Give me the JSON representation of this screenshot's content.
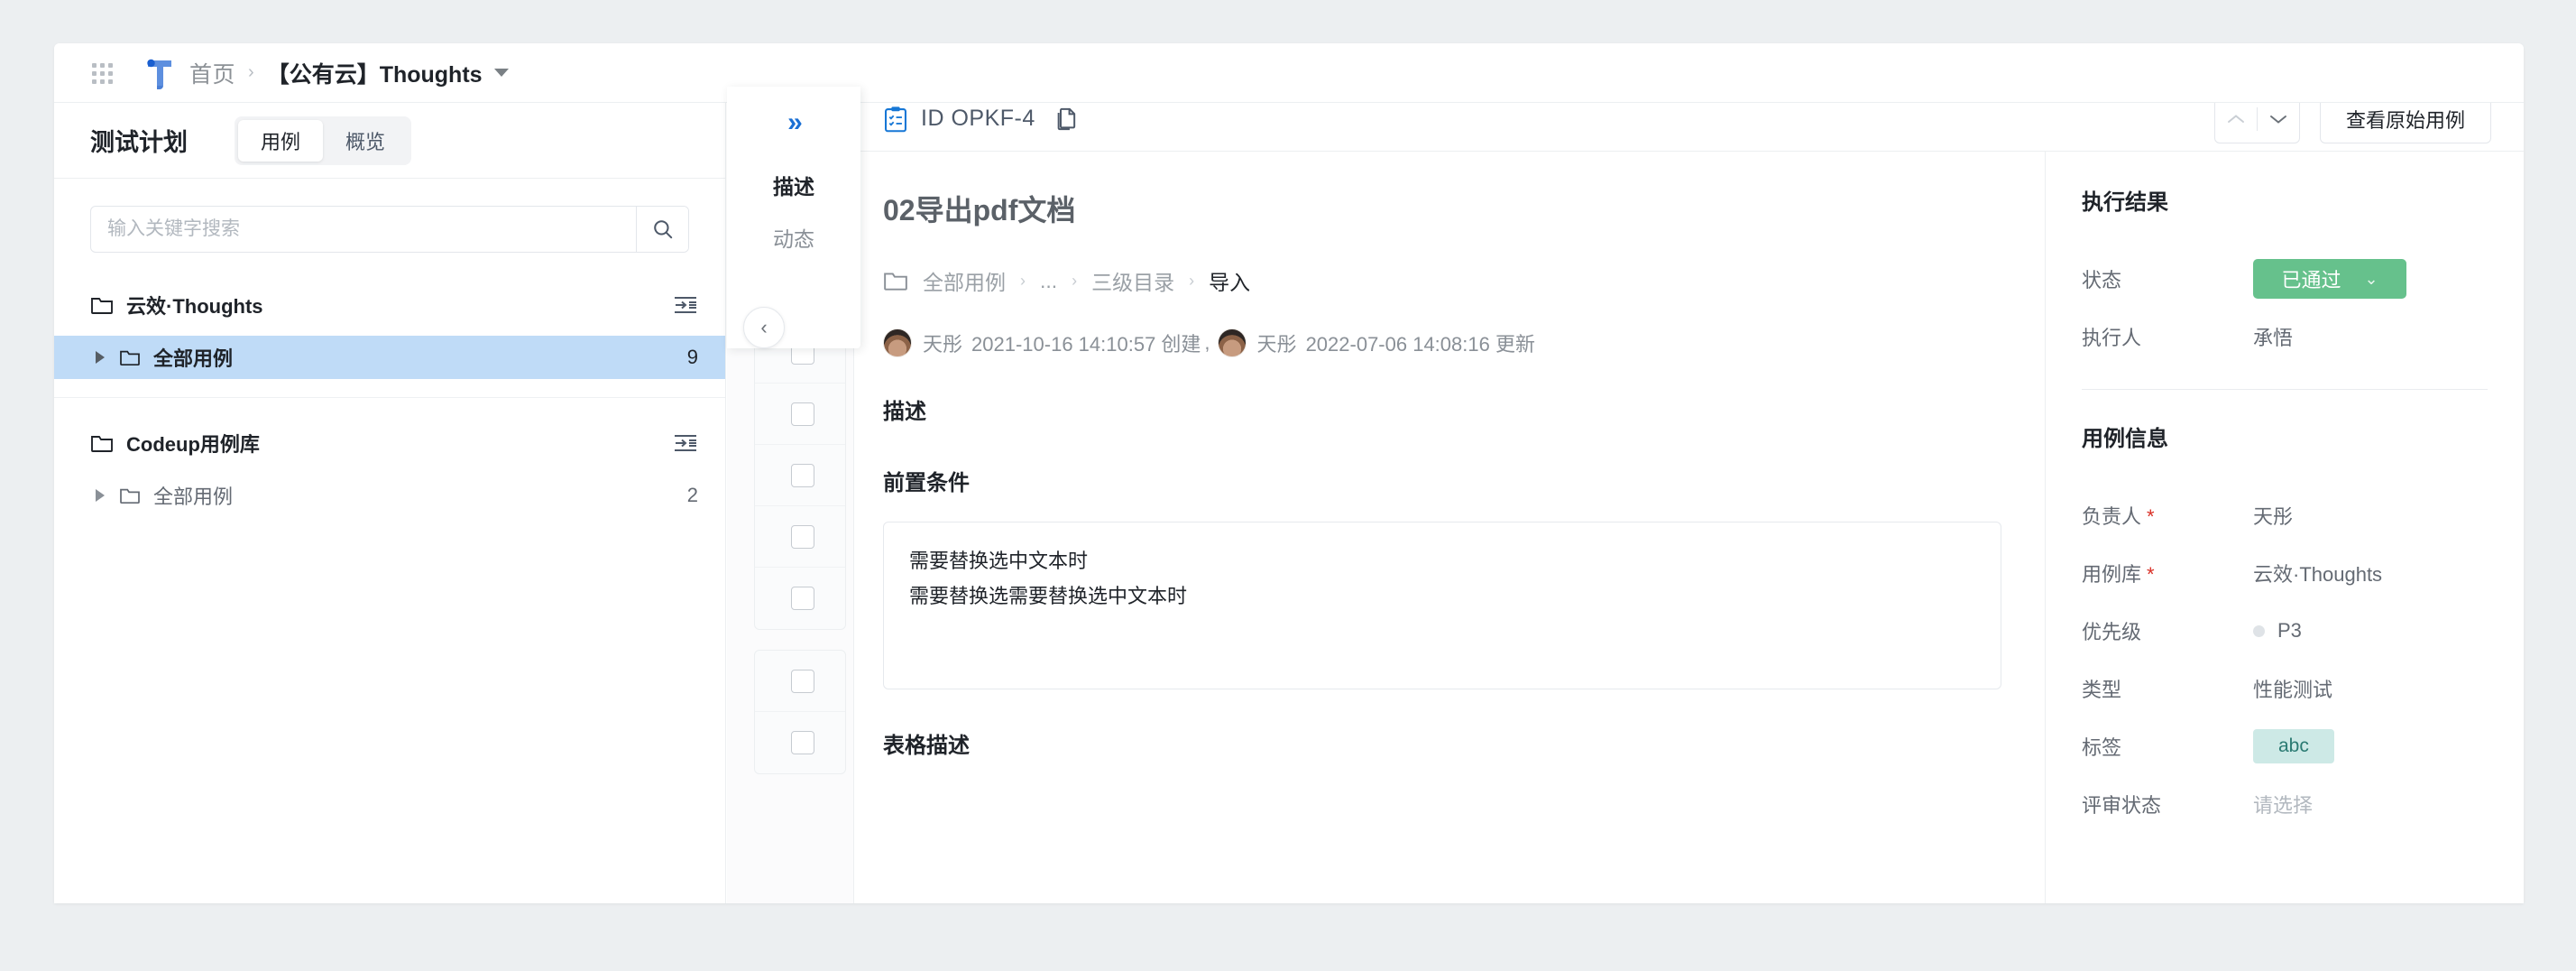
{
  "topbar": {
    "apps_icon": "grid-apps-icon",
    "logo": "thoughts-logo",
    "breadcrumb_home": "首页",
    "breadcrumb_sep": "›",
    "breadcrumb_current": "【公有云】Thoughts"
  },
  "sidebar": {
    "plan_title": "测试计划",
    "tabs": [
      {
        "label": "用例",
        "active": true
      },
      {
        "label": "概览",
        "active": false
      }
    ],
    "search": {
      "placeholder": "输入关键字搜索",
      "value": "",
      "icon": "search-icon"
    },
    "groups": [
      {
        "root_label": "云效·Thoughts",
        "root_icon": "folder-icon",
        "action_icon": "indent-import-icon",
        "nodes": [
          {
            "label": "全部用例",
            "count": "9",
            "selected": true
          }
        ]
      },
      {
        "root_label": "Codeup用例库",
        "root_icon": "folder-icon",
        "action_icon": "indent-import-icon",
        "nodes": [
          {
            "label": "全部用例",
            "count": "2",
            "selected": false
          }
        ]
      }
    ]
  },
  "drawer": {
    "expand_icon": "»",
    "collapse_icon": "‹",
    "tabs": [
      {
        "label": "描述",
        "active": true
      },
      {
        "label": "动态",
        "active": false
      }
    ]
  },
  "detail": {
    "header": {
      "case_icon": "clipboard-check-icon",
      "id_label": "ID OPKF-4",
      "copy_icon": "copy-icon",
      "prev_icon": "chevron-up-icon",
      "next_icon": "chevron-down-icon",
      "view_original_label": "查看原始用例"
    },
    "title": "02导出pdf文档",
    "breadcrumb": {
      "folder_icon": "folder-icon",
      "items": [
        "全部用例",
        "...",
        "三级目录",
        "导入"
      ]
    },
    "meta": {
      "created_by": "天彤",
      "created_text": "2021-10-16 14:10:57 创建",
      "separator": ",",
      "updated_by": "天彤",
      "updated_text": "2022-07-06 14:08:16 更新"
    },
    "sections": {
      "description_heading": "描述",
      "precondition_heading": "前置条件",
      "precondition_lines": [
        "需要替换选中文本时",
        "需要替换选需要替换选中文本时"
      ],
      "table_desc_heading": "表格描述"
    }
  },
  "side_panel": {
    "exec_heading": "执行结果",
    "exec_fields": [
      {
        "label": "状态",
        "type": "badge",
        "value": "已通过",
        "chevron": "⌄",
        "color": "#66c18c"
      },
      {
        "label": "执行人",
        "type": "text",
        "value": "承悟"
      }
    ],
    "info_heading": "用例信息",
    "info_fields": [
      {
        "label": "负责人",
        "required": true,
        "type": "text",
        "value": "天彤"
      },
      {
        "label": "用例库",
        "required": true,
        "type": "text",
        "value": "云效·Thoughts"
      },
      {
        "label": "优先级",
        "required": false,
        "type": "priority",
        "value": "P3",
        "dot_color": "#dfe3e7"
      },
      {
        "label": "类型",
        "required": false,
        "type": "text",
        "value": "性能测试"
      },
      {
        "label": "标签",
        "required": false,
        "type": "tag",
        "value": "abc",
        "tag_bg": "#cde9e6",
        "tag_color": "#2a7a72"
      },
      {
        "label": "评审状态",
        "required": false,
        "type": "placeholder",
        "value": "请选择"
      }
    ]
  }
}
